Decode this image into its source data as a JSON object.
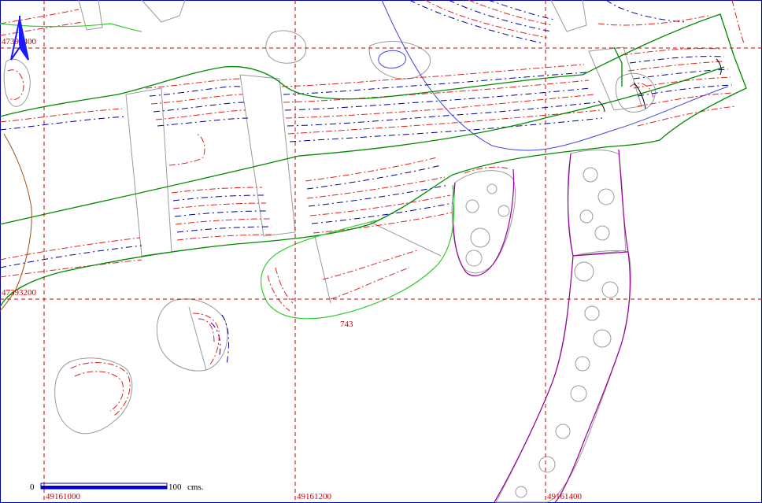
{
  "grid": {
    "x_labels": [
      "49161000",
      "49161200",
      "49161400"
    ],
    "y_labels": [
      "47393400",
      "47393200"
    ],
    "color": "#cc0000"
  },
  "feature_label": "743",
  "scale_bar": {
    "start": "0",
    "end": "100",
    "unit": "cms."
  },
  "north_arrow": {
    "color": "#1a1aff"
  },
  "colors": {
    "contour_red": "#e02020",
    "contour_blue": "#000099",
    "boundary_green": "#008800",
    "light_green": "#33cc33",
    "stone_gray": "#9a9a9a",
    "purple": "#990099",
    "blue_line": "#4444dd",
    "brown": "#a05010"
  }
}
